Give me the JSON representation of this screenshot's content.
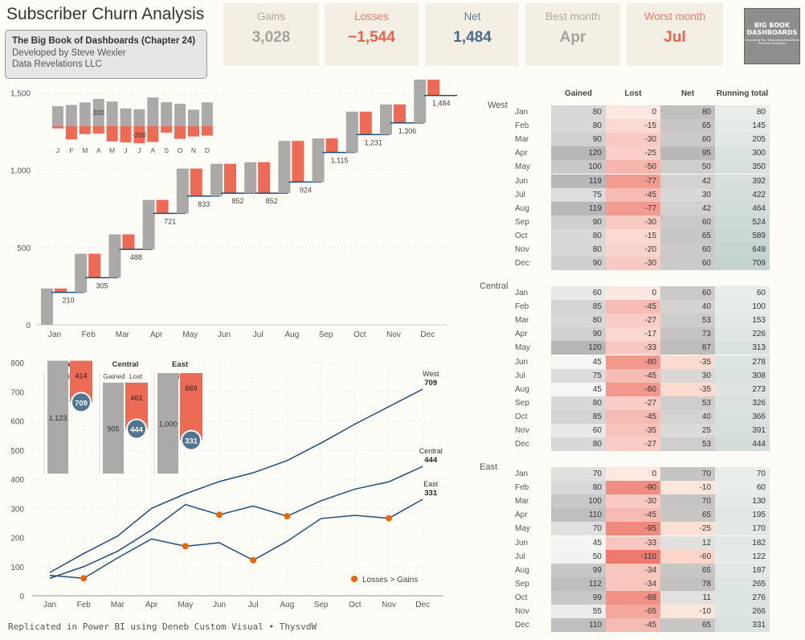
{
  "title": "Subscriber Churn Analysis",
  "info": {
    "line1": "The Big Book of Dashboards (Chapter 24)",
    "line2": "Developed by Steve Wexler",
    "line3": "Data Revelations LLC"
  },
  "kpis": [
    {
      "label": "Gains",
      "value": "3,028",
      "label_color": "#b0a9a4",
      "value_color": "#a8a29d"
    },
    {
      "label": "Losses",
      "value": "−1,544",
      "label_color": "#ed7c68",
      "value_color": "#e8624e"
    },
    {
      "label": "Net",
      "value": "1,484",
      "label_color": "#607e98",
      "value_color": "#4a6b88"
    },
    {
      "label": "Best month",
      "value": "Apr",
      "label_color": "#b0a9a4",
      "value_color": "#a8a29d"
    },
    {
      "label": "Worst month",
      "value": "Jul",
      "label_color": "#ed7c68",
      "value_color": "#e8624e"
    }
  ],
  "logo": {
    "line1": "BIG BOOK",
    "line2": "DASHBOARDS",
    "sub": "Visualizing Your Data Using Real-World Business Scenarios"
  },
  "footer": "Replicated in Power BI using Deneb Custom Visual • ThysvdW",
  "colors": {
    "gain": "#acaaa8",
    "loss": "#ed6a55",
    "net": "#1f4e79",
    "running_marker": "#517590",
    "loss_dot": "#e8660c",
    "background": "#fdfcf7"
  },
  "chart_data": [
    {
      "type": "bar",
      "subtype": "waterfall",
      "categories": [
        "Jan",
        "Feb",
        "Mar",
        "Apr",
        "May",
        "Jun",
        "Jul",
        "Aug",
        "Sep",
        "Oct",
        "Nov",
        "Dec"
      ],
      "gains": [
        235,
        250,
        280,
        320,
        290,
        209,
        200,
        338,
        282,
        264,
        195,
        280
      ],
      "losses": [
        -25,
        -155,
        -92,
        -87,
        -178,
        -190,
        -200,
        -184,
        -75,
        -148,
        -120,
        -110
      ],
      "running_total": [
        210,
        305,
        488,
        721,
        833,
        852,
        852,
        924,
        1115,
        1231,
        1306,
        1484
      ],
      "yticks": [
        0,
        500,
        1000,
        1500
      ],
      "ylim": [
        0,
        1550
      ],
      "inset": {
        "type": "bar",
        "categories": [
          "J",
          "F",
          "M",
          "A",
          "M",
          "J",
          "J",
          "A",
          "S",
          "O",
          "N",
          "D"
        ],
        "gains": [
          235,
          250,
          280,
          320,
          290,
          209,
          200,
          338,
          282,
          264,
          195,
          280
        ],
        "losses": [
          -25,
          -155,
          -92,
          -87,
          -178,
          -190,
          -200,
          -184,
          -75,
          -148,
          -120,
          -110
        ],
        "labels": [
          {
            "index": 3,
            "text": "320"
          },
          {
            "index": 6,
            "text": "-200"
          }
        ]
      }
    },
    {
      "type": "line",
      "categories": [
        "Jan",
        "Feb",
        "Mar",
        "Apr",
        "May",
        "Jun",
        "Jul",
        "Aug",
        "Sep",
        "Oct",
        "Nov",
        "Dec"
      ],
      "yticks": [
        0,
        100,
        200,
        300,
        400,
        500,
        600,
        700,
        800
      ],
      "ylim": [
        0,
        800
      ],
      "series": [
        {
          "name": "West",
          "values": [
            80,
            145,
            205,
            300,
            350,
            392,
            422,
            464,
            524,
            589,
            649,
            709
          ],
          "end_label": "709"
        },
        {
          "name": "Central",
          "values": [
            60,
            100,
            153,
            226,
            313,
            278,
            308,
            273,
            326,
            366,
            391,
            444
          ],
          "end_label": "444"
        },
        {
          "name": "East",
          "values": [
            70,
            60,
            130,
            195,
            170,
            182,
            122,
            187,
            265,
            276,
            266,
            331
          ],
          "end_label": "331"
        }
      ],
      "legend": "Losses > Gains",
      "legend_position": "bottom-right",
      "region_summary": [
        {
          "name": "West",
          "gained": 1123,
          "lost": 414,
          "net": 709,
          "gained_label": "1,123",
          "lost_label": "414",
          "net_label": "709"
        },
        {
          "name": "Central",
          "gained": 905,
          "lost": 461,
          "net": 444,
          "gained_label": "905",
          "lost_label": "461",
          "net_label": "444"
        },
        {
          "name": "East",
          "gained": 1000,
          "lost": 669,
          "net": 331,
          "gained_label": "1,000",
          "lost_label": "669",
          "net_label": "331"
        }
      ],
      "summary_labels": {
        "gained": "Gained",
        "lost": "Lost"
      }
    },
    {
      "type": "table",
      "columns": [
        "Gained",
        "Lost",
        "Net",
        "Running total"
      ],
      "regions": [
        {
          "name": "West",
          "rows": [
            [
              "Jan",
              80,
              0,
              80,
              80
            ],
            [
              "Feb",
              80,
              -15,
              65,
              145
            ],
            [
              "Mar",
              90,
              -30,
              60,
              205
            ],
            [
              "Apr",
              120,
              -25,
              95,
              300
            ],
            [
              "May",
              100,
              -50,
              50,
              350
            ],
            [
              "Jun",
              119,
              -77,
              42,
              392
            ],
            [
              "Jul",
              75,
              -45,
              30,
              422
            ],
            [
              "Aug",
              119,
              -77,
              42,
              464
            ],
            [
              "Sep",
              90,
              -30,
              60,
              524
            ],
            [
              "Oct",
              80,
              -15,
              65,
              589
            ],
            [
              "Nov",
              80,
              -20,
              60,
              649
            ],
            [
              "Dec",
              90,
              -30,
              60,
              709
            ]
          ]
        },
        {
          "name": "Central",
          "rows": [
            [
              "Jan",
              60,
              0,
              60,
              60
            ],
            [
              "Feb",
              85,
              -45,
              40,
              100
            ],
            [
              "Mar",
              80,
              -27,
              53,
              153
            ],
            [
              "Apr",
              90,
              -17,
              73,
              226
            ],
            [
              "May",
              120,
              -33,
              87,
              313
            ],
            [
              "Jun",
              45,
              -80,
              -35,
              278
            ],
            [
              "Jul",
              75,
              -45,
              30,
              308
            ],
            [
              "Aug",
              45,
              -80,
              -35,
              273
            ],
            [
              "Sep",
              80,
              -27,
              53,
              326
            ],
            [
              "Oct",
              85,
              -45,
              40,
              366
            ],
            [
              "Nov",
              60,
              -35,
              25,
              391
            ],
            [
              "Dec",
              80,
              -27,
              53,
              444
            ]
          ]
        },
        {
          "name": "East",
          "rows": [
            [
              "Jan",
              70,
              0,
              70,
              70
            ],
            [
              "Feb",
              80,
              -90,
              -10,
              60
            ],
            [
              "Mar",
              100,
              -30,
              70,
              130
            ],
            [
              "Apr",
              110,
              -45,
              65,
              195
            ],
            [
              "May",
              70,
              -95,
              -25,
              170
            ],
            [
              "Jun",
              45,
              -33,
              12,
              182
            ],
            [
              "Jul",
              50,
              -110,
              -60,
              122
            ],
            [
              "Aug",
              99,
              -34,
              65,
              187
            ],
            [
              "Sep",
              112,
              -34,
              78,
              265
            ],
            [
              "Oct",
              99,
              -88,
              11,
              276
            ],
            [
              "Nov",
              55,
              -65,
              -10,
              266
            ],
            [
              "Dec",
              110,
              -45,
              65,
              331
            ]
          ]
        }
      ]
    }
  ]
}
